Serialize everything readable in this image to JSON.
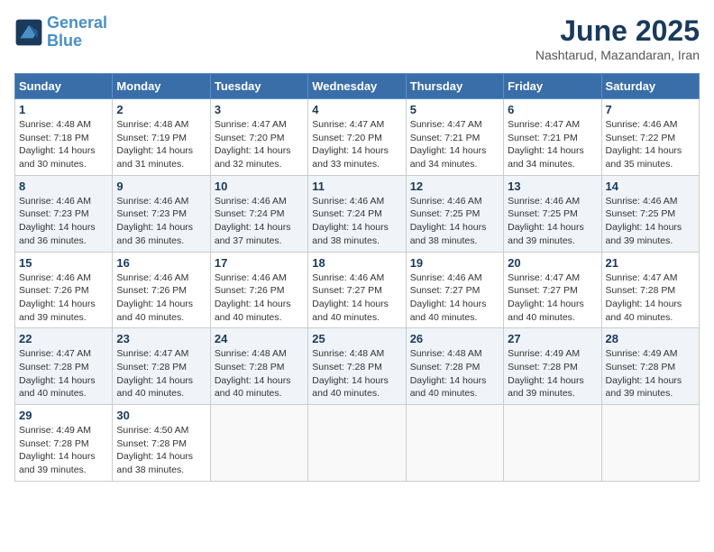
{
  "header": {
    "logo_line1": "General",
    "logo_line2": "Blue",
    "month": "June 2025",
    "location": "Nashtarud, Mazandaran, Iran"
  },
  "weekdays": [
    "Sunday",
    "Monday",
    "Tuesday",
    "Wednesday",
    "Thursday",
    "Friday",
    "Saturday"
  ],
  "weeks": [
    [
      {
        "day": 1,
        "info": "Sunrise: 4:48 AM\nSunset: 7:18 PM\nDaylight: 14 hours\nand 30 minutes."
      },
      {
        "day": 2,
        "info": "Sunrise: 4:48 AM\nSunset: 7:19 PM\nDaylight: 14 hours\nand 31 minutes."
      },
      {
        "day": 3,
        "info": "Sunrise: 4:47 AM\nSunset: 7:20 PM\nDaylight: 14 hours\nand 32 minutes."
      },
      {
        "day": 4,
        "info": "Sunrise: 4:47 AM\nSunset: 7:20 PM\nDaylight: 14 hours\nand 33 minutes."
      },
      {
        "day": 5,
        "info": "Sunrise: 4:47 AM\nSunset: 7:21 PM\nDaylight: 14 hours\nand 34 minutes."
      },
      {
        "day": 6,
        "info": "Sunrise: 4:47 AM\nSunset: 7:21 PM\nDaylight: 14 hours\nand 34 minutes."
      },
      {
        "day": 7,
        "info": "Sunrise: 4:46 AM\nSunset: 7:22 PM\nDaylight: 14 hours\nand 35 minutes."
      }
    ],
    [
      {
        "day": 8,
        "info": "Sunrise: 4:46 AM\nSunset: 7:23 PM\nDaylight: 14 hours\nand 36 minutes."
      },
      {
        "day": 9,
        "info": "Sunrise: 4:46 AM\nSunset: 7:23 PM\nDaylight: 14 hours\nand 36 minutes."
      },
      {
        "day": 10,
        "info": "Sunrise: 4:46 AM\nSunset: 7:24 PM\nDaylight: 14 hours\nand 37 minutes."
      },
      {
        "day": 11,
        "info": "Sunrise: 4:46 AM\nSunset: 7:24 PM\nDaylight: 14 hours\nand 38 minutes."
      },
      {
        "day": 12,
        "info": "Sunrise: 4:46 AM\nSunset: 7:25 PM\nDaylight: 14 hours\nand 38 minutes."
      },
      {
        "day": 13,
        "info": "Sunrise: 4:46 AM\nSunset: 7:25 PM\nDaylight: 14 hours\nand 39 minutes."
      },
      {
        "day": 14,
        "info": "Sunrise: 4:46 AM\nSunset: 7:25 PM\nDaylight: 14 hours\nand 39 minutes."
      }
    ],
    [
      {
        "day": 15,
        "info": "Sunrise: 4:46 AM\nSunset: 7:26 PM\nDaylight: 14 hours\nand 39 minutes."
      },
      {
        "day": 16,
        "info": "Sunrise: 4:46 AM\nSunset: 7:26 PM\nDaylight: 14 hours\nand 40 minutes."
      },
      {
        "day": 17,
        "info": "Sunrise: 4:46 AM\nSunset: 7:26 PM\nDaylight: 14 hours\nand 40 minutes."
      },
      {
        "day": 18,
        "info": "Sunrise: 4:46 AM\nSunset: 7:27 PM\nDaylight: 14 hours\nand 40 minutes."
      },
      {
        "day": 19,
        "info": "Sunrise: 4:46 AM\nSunset: 7:27 PM\nDaylight: 14 hours\nand 40 minutes."
      },
      {
        "day": 20,
        "info": "Sunrise: 4:47 AM\nSunset: 7:27 PM\nDaylight: 14 hours\nand 40 minutes."
      },
      {
        "day": 21,
        "info": "Sunrise: 4:47 AM\nSunset: 7:28 PM\nDaylight: 14 hours\nand 40 minutes."
      }
    ],
    [
      {
        "day": 22,
        "info": "Sunrise: 4:47 AM\nSunset: 7:28 PM\nDaylight: 14 hours\nand 40 minutes."
      },
      {
        "day": 23,
        "info": "Sunrise: 4:47 AM\nSunset: 7:28 PM\nDaylight: 14 hours\nand 40 minutes."
      },
      {
        "day": 24,
        "info": "Sunrise: 4:48 AM\nSunset: 7:28 PM\nDaylight: 14 hours\nand 40 minutes."
      },
      {
        "day": 25,
        "info": "Sunrise: 4:48 AM\nSunset: 7:28 PM\nDaylight: 14 hours\nand 40 minutes."
      },
      {
        "day": 26,
        "info": "Sunrise: 4:48 AM\nSunset: 7:28 PM\nDaylight: 14 hours\nand 40 minutes."
      },
      {
        "day": 27,
        "info": "Sunrise: 4:49 AM\nSunset: 7:28 PM\nDaylight: 14 hours\nand 39 minutes."
      },
      {
        "day": 28,
        "info": "Sunrise: 4:49 AM\nSunset: 7:28 PM\nDaylight: 14 hours\nand 39 minutes."
      }
    ],
    [
      {
        "day": 29,
        "info": "Sunrise: 4:49 AM\nSunset: 7:28 PM\nDaylight: 14 hours\nand 39 minutes."
      },
      {
        "day": 30,
        "info": "Sunrise: 4:50 AM\nSunset: 7:28 PM\nDaylight: 14 hours\nand 38 minutes."
      },
      null,
      null,
      null,
      null,
      null
    ]
  ]
}
